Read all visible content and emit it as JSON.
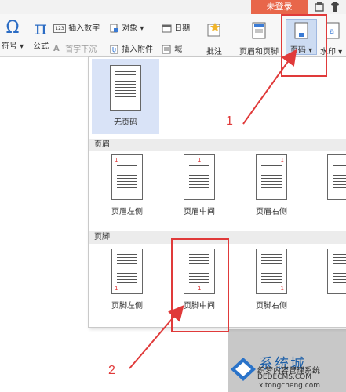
{
  "titlebar": {
    "login_label": "未登录"
  },
  "ribbon": {
    "symbol_label": "符号",
    "formula_label": "公式",
    "insert_number_label": "插入数字",
    "first_char_sink_label": "首字下沉",
    "object_label": "对象",
    "insert_attachment_label": "插入附件",
    "date_label": "日期",
    "field_label": "域",
    "comment_label": "批注",
    "header_footer_label": "页眉和页脚",
    "page_number_label": "页码",
    "watermark_label": "水印"
  },
  "dropdown": {
    "no_page_number_label": "无页码",
    "header_section_label": "页眉",
    "footer_section_label": "页脚",
    "header_options": [
      {
        "label": "页眉左侧",
        "num": "1"
      },
      {
        "label": "页眉中间",
        "num": "1"
      },
      {
        "label": "页眉右侧",
        "num": "1"
      }
    ],
    "footer_options": [
      {
        "label": "页脚左侧",
        "num": "1"
      },
      {
        "label": "页脚中间",
        "num": "1"
      },
      {
        "label": "页脚右侧",
        "num": "1"
      }
    ]
  },
  "annotations": {
    "step1": "1",
    "step2": "2"
  },
  "watermark_site": {
    "brand": "系统城",
    "subtitle": "织梦内容管理系统",
    "url1": "DEDECMS.COM",
    "url2": "xitongcheng.com"
  },
  "colors": {
    "accent_red": "#e03a3a",
    "login_orange": "#e8664a",
    "selected_bg": "#d9e3f7"
  }
}
